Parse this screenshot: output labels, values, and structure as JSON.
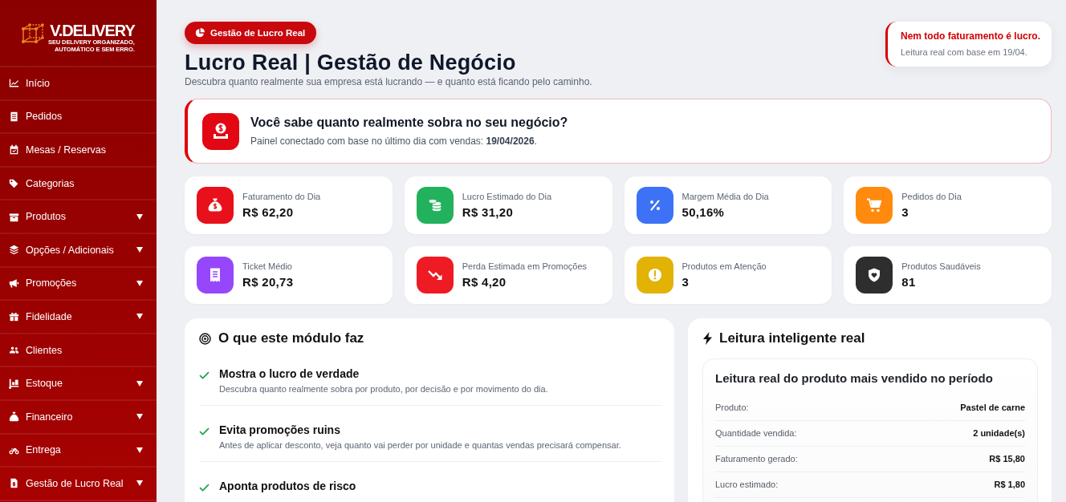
{
  "sidebar": {
    "logo": {
      "wordmark": "V.DELIVERY",
      "tagline": [
        "SEU DELIVERY ORGANIZADO,",
        "AUTOMÁTICO E SEM ERRO."
      ]
    },
    "items": [
      {
        "label": "Início",
        "has_submenu": false
      },
      {
        "label": "Pedidos",
        "has_submenu": false
      },
      {
        "label": "Mesas / Reservas",
        "has_submenu": false
      },
      {
        "label": "Categorias",
        "has_submenu": false
      },
      {
        "label": "Produtos",
        "has_submenu": true
      },
      {
        "label": "Opções / Adicionais",
        "has_submenu": true
      },
      {
        "label": "Promoções",
        "has_submenu": true
      },
      {
        "label": "Fidelidade",
        "has_submenu": true
      },
      {
        "label": "Clientes",
        "has_submenu": false
      },
      {
        "label": "Estoque",
        "has_submenu": true
      },
      {
        "label": "Financeiro",
        "has_submenu": true
      },
      {
        "label": "Entrega",
        "has_submenu": true
      },
      {
        "label": "Gestão de Lucro Real",
        "has_submenu": true
      }
    ]
  },
  "header": {
    "badge": "Gestão de Lucro Real",
    "title": "Lucro Real | Gestão de Negócio",
    "subtitle": "Descubra quanto realmente sua empresa está lucrando — e quanto está ficando pelo caminho."
  },
  "notice": {
    "title": "Nem todo faturamento é lucro.",
    "text": "Leitura real com base em 19/04."
  },
  "hero": {
    "title": "Você sabe quanto realmente sobra no seu negócio?",
    "text": "Painel conectado com base no último dia com vendas: **19/04/2026**."
  },
  "stats": [
    {
      "label": "Faturamento do Dia",
      "value": "R$ 62,20",
      "color": "#e8101a"
    },
    {
      "label": "Lucro Estimado do Dia",
      "value": "R$ 31,20",
      "color": "#22b15c"
    },
    {
      "label": "Margem Média do Dia",
      "value": "50,16%",
      "color": "#3d72f6"
    },
    {
      "label": "Pedidos do Dia",
      "value": "3",
      "color": "#ff8a0d"
    },
    {
      "label": "Ticket Médio",
      "value": "R$ 20,73",
      "color": "#9647fb"
    },
    {
      "label": "Perda Estimada em Promoções",
      "value": "R$ 4,20",
      "color": "#ee1b24"
    },
    {
      "label": "Produtos em Atenção",
      "value": "3",
      "color": "#e2b205"
    },
    {
      "label": "Produtos Saudáveis",
      "value": "81",
      "color": "#2e2e2e"
    }
  ],
  "module_panel": {
    "title": "O que este módulo faz",
    "features": [
      {
        "title": "Mostra o lucro de verdade",
        "text": "Descubra quanto realmente sobra por produto, por decisão e por movimento do dia."
      },
      {
        "title": "Evita promoções ruins",
        "text": "Antes de aplicar desconto, veja quanto vai perder por unidade e quantas vendas precisará compensar."
      },
      {
        "title": "Aponta produtos de risco"
      }
    ]
  },
  "insight_panel": {
    "title": "Leitura inteligente real",
    "card": {
      "title": "Leitura real do produto mais vendido no período",
      "rows": [
        {
          "label": "Produto:",
          "value": "Pastel de carne"
        },
        {
          "label": "Quantidade vendida:",
          "value": "2 unidade(s)"
        },
        {
          "label": "Faturamento gerado:",
          "value": "R$ 15,80"
        },
        {
          "label": "Lucro estimado:",
          "value": "R$ 1,80"
        }
      ]
    }
  }
}
